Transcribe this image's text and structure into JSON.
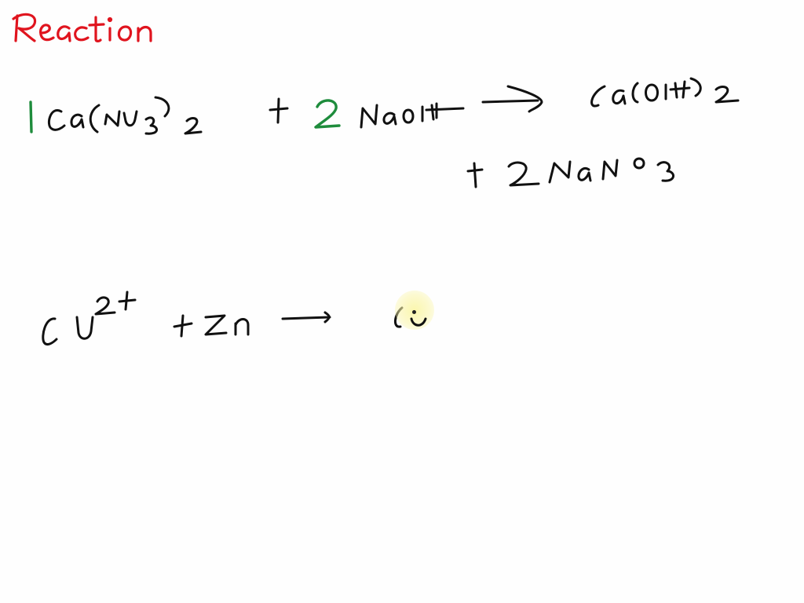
{
  "page": {
    "heading": "Reaction",
    "colors": {
      "heading": "#e0141e",
      "coefficient": "#1e8c3c",
      "ink": "#111111",
      "cursor_highlight": "#f8f3a0",
      "background": "#ffffff"
    }
  },
  "equations": [
    {
      "id": "eq1",
      "text": "1 Ca(NO3)2 + 2 NaOH → Ca(OH)2 + 2 NaNO3",
      "reactants": [
        {
          "coefficient": "1",
          "formula": "Ca(NO3)2"
        },
        {
          "coefficient": "2",
          "formula": "NaOH"
        }
      ],
      "arrow": "→",
      "products": [
        {
          "coefficient": "",
          "formula": "Ca(OH)2"
        },
        {
          "coefficient": "2",
          "formula": "NaNO3"
        }
      ]
    },
    {
      "id": "eq2",
      "text": "Cu2+ + Zn → Cu",
      "reactants": [
        {
          "coefficient": "",
          "formula": "Cu2+"
        },
        {
          "coefficient": "",
          "formula": "Zn"
        }
      ],
      "arrow": "→",
      "products": [
        {
          "coefficient": "",
          "formula": "Cu"
        }
      ],
      "in_progress": true
    }
  ],
  "pointer": {
    "icon": "pen-cursor-highlight"
  }
}
